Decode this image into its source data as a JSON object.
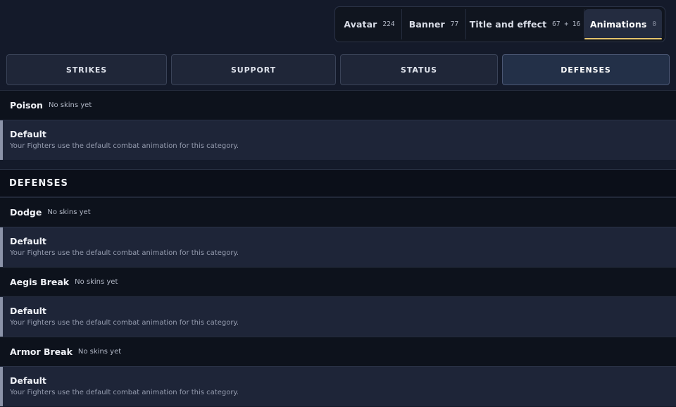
{
  "tabs": [
    {
      "label": "Avatar",
      "count": "224"
    },
    {
      "label": "Banner",
      "count": "77"
    },
    {
      "label": "Title and effect",
      "count": "67 + 16"
    },
    {
      "label": "Animations",
      "count": "0",
      "active": true
    }
  ],
  "categories": [
    {
      "label": "STRIKES"
    },
    {
      "label": "SUPPORT"
    },
    {
      "label": "STATUS"
    },
    {
      "label": "DEFENSES",
      "active": true
    }
  ],
  "status_group": {
    "skins": [
      {
        "name": "Poison",
        "note": "No skins yet",
        "option_title": "Default",
        "option_desc": "Your Fighters use the default combat animation for this category."
      }
    ]
  },
  "defenses_section": {
    "title": "DEFENSES",
    "skins": [
      {
        "name": "Dodge",
        "note": "No skins yet",
        "option_title": "Default",
        "option_desc": "Your Fighters use the default combat animation for this category."
      },
      {
        "name": "Aegis Break",
        "note": "No skins yet",
        "option_title": "Default",
        "option_desc": "Your Fighters use the default combat animation for this category."
      },
      {
        "name": "Armor Break",
        "note": "No skins yet",
        "option_title": "Default",
        "option_desc": "Your Fighters use the default combat animation for this category."
      }
    ]
  },
  "colors": {
    "accent_active": "#e5c46b",
    "background": "#141a2a",
    "row_header_bg": "#0d121c",
    "option_bg": "#1e2538"
  }
}
